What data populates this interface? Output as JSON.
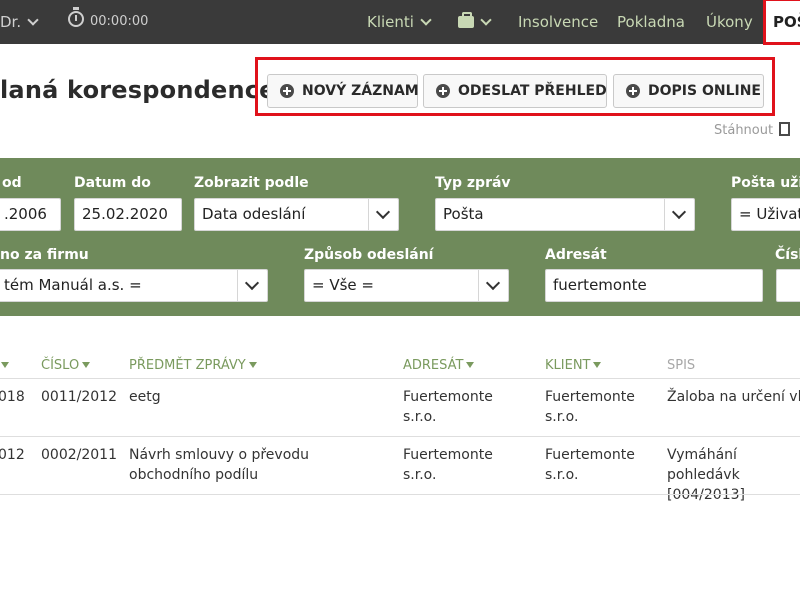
{
  "nav": {
    "user": "Dr.",
    "timer": "00:00:00",
    "klienti": "Klienti",
    "insolvence": "Insolvence",
    "pokladna": "Pokladna",
    "ukony": "Úkony",
    "posta": "POŠ"
  },
  "page": {
    "title": "laná korespondence",
    "buttons": {
      "new_record": "NOVÝ ZÁZNAM",
      "send_overview": "ODESLAT PŘEHLED",
      "letter_online": "DOPIS ONLINE"
    },
    "download": "Stáhnout"
  },
  "filters": {
    "date_from": {
      "label": "od",
      "value": ".2006"
    },
    "date_to": {
      "label": "Datum do",
      "value": "25.02.2020"
    },
    "show_by": {
      "label": "Zobrazit podle",
      "value": "Data odeslání"
    },
    "message_type": {
      "label": "Typ zpráv",
      "value": "Pošta"
    },
    "user_post": {
      "label": "Pošta uživ",
      "value": "= Uživate"
    },
    "company": {
      "label": "no za firmu",
      "value": "tém Manuál a.s. ="
    },
    "send_method": {
      "label": "Způsob odeslání",
      "value": "= Vše ="
    },
    "recipient": {
      "label": "Adresát",
      "value": "fuertemonte"
    },
    "number": {
      "label": "Čísl",
      "value": ""
    }
  },
  "table": {
    "headers": {
      "number": "ČÍSLO",
      "subject": "PŘEDMĚT ZPRÁVY",
      "recipient": "ADRESÁT",
      "client": "KLIENT",
      "file": "SPIS"
    },
    "rows": [
      {
        "date": "018",
        "number": "0011/2012",
        "subject": "eetg",
        "recipient": "Fuertemonte s.r.o.",
        "client": "Fuertemonte s.r.o.",
        "file": "Žaloba na určení vla"
      },
      {
        "date": "012",
        "number": "0002/2011",
        "subject": "Návrh smlouvy o převodu obchodního podílu",
        "recipient": "Fuertemonte s.r.o.",
        "client": "Fuertemonte s.r.o.",
        "file": "Vymáhání pohledávk [004/2013]"
      }
    ]
  }
}
